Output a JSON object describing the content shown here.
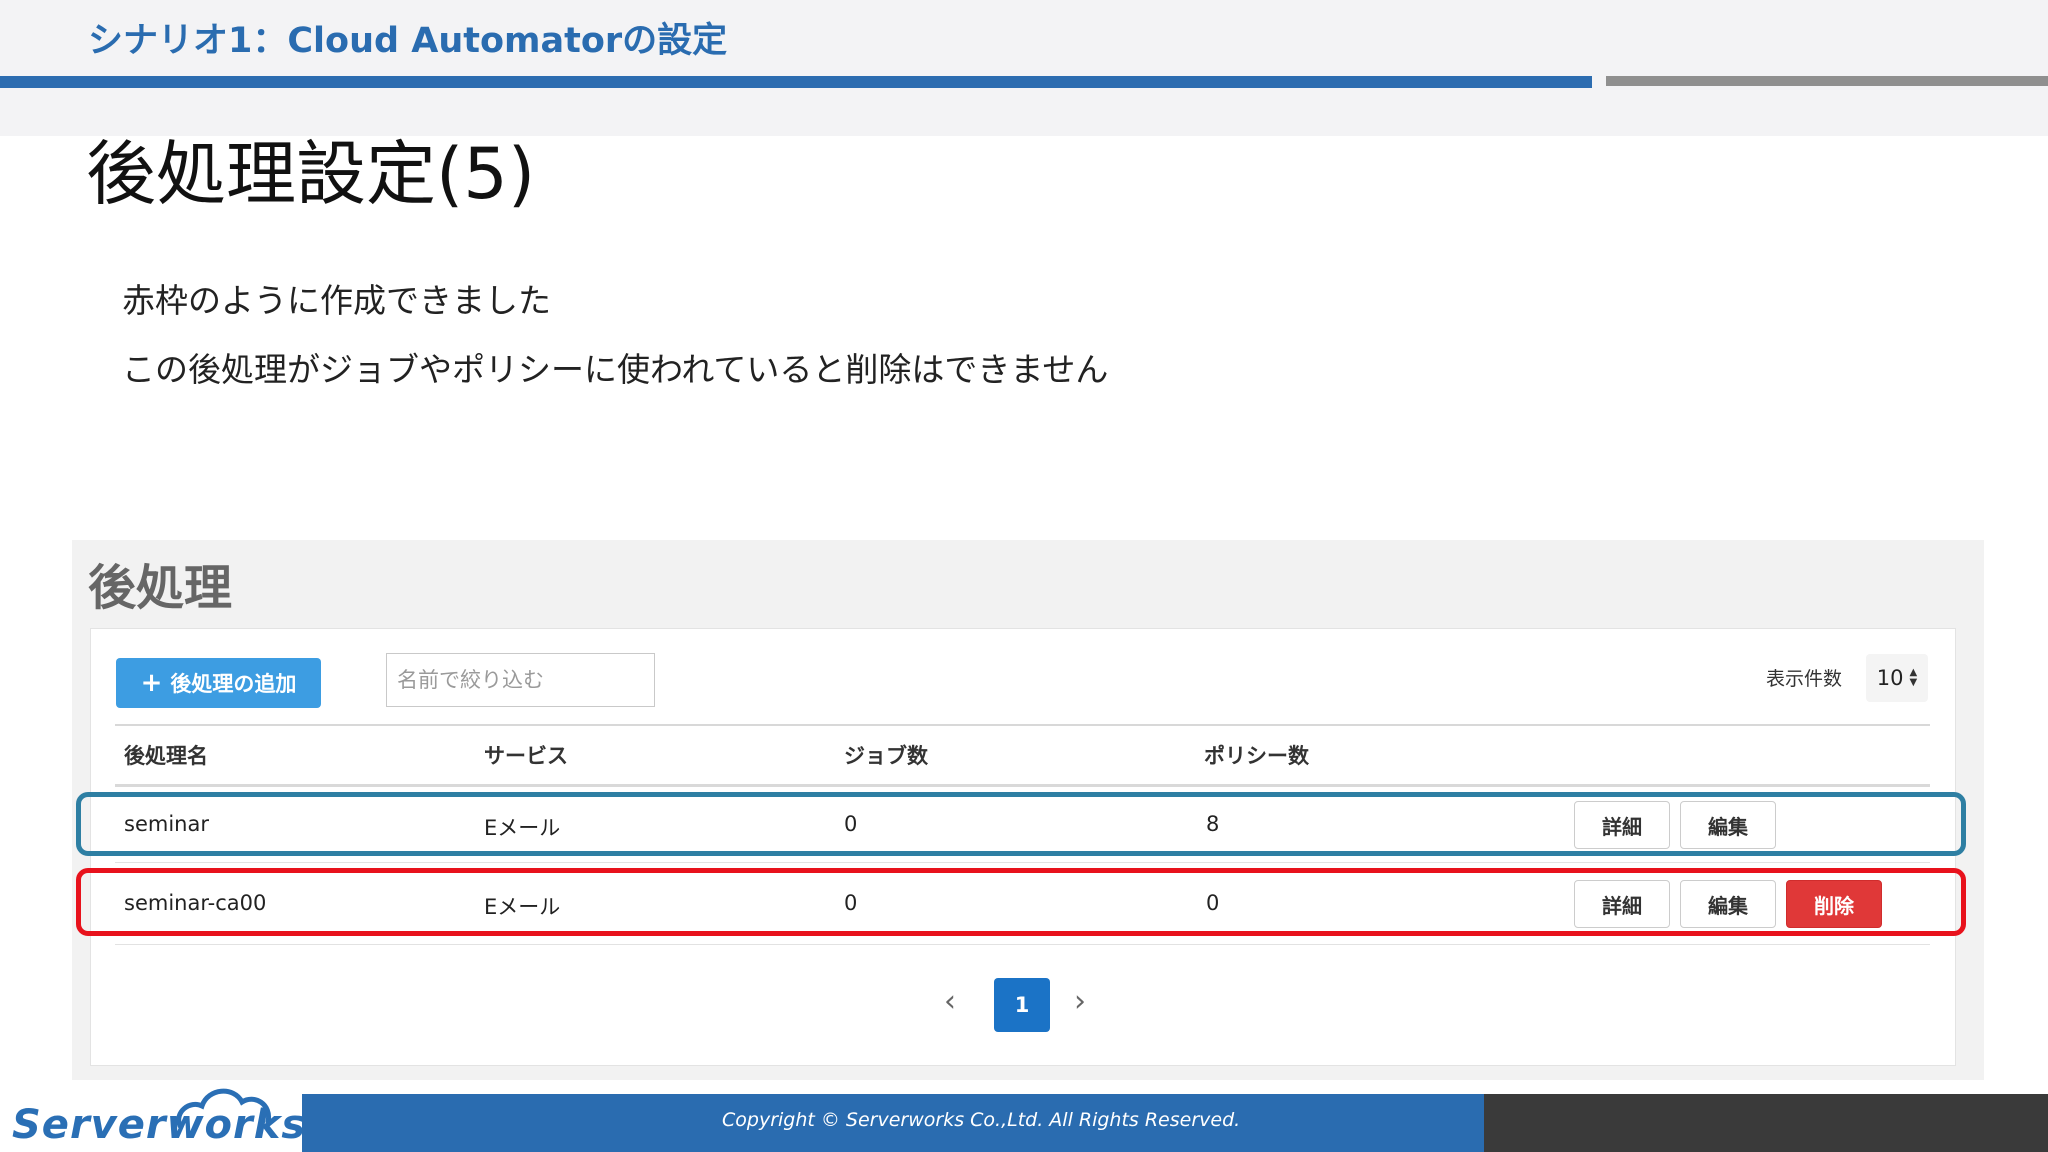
{
  "header": {
    "scenario_title": "シナリオ1：Cloud Automatorの設定"
  },
  "slide": {
    "title": "後処理設定(5)",
    "lines": [
      "赤枠のように作成できました",
      "この後処理がジョブやポリシーに使われていると削除はできません"
    ]
  },
  "app": {
    "panel_title": "後処理",
    "add_button_label": "後処理の追加",
    "filter_placeholder": "名前で絞り込む",
    "per_page_label": "表示件数",
    "per_page_value": "10",
    "columns": [
      "後処理名",
      "サービス",
      "ジョブ数",
      "ポリシー数"
    ],
    "rows": [
      {
        "name": "seminar",
        "service": "Eメール",
        "jobs": "0",
        "policies": "8",
        "detail_label": "詳細",
        "edit_label": "編集"
      },
      {
        "name": "seminar-ca00",
        "service": "Eメール",
        "jobs": "0",
        "policies": "0",
        "detail_label": "詳細",
        "edit_label": "編集",
        "delete_label": "削除"
      }
    ],
    "pagination": {
      "prev_icon": "‹",
      "current_page": "1",
      "next_icon": "›"
    },
    "icons": {
      "add": "plus-icon",
      "per_page": "sort-icon",
      "prev": "chevron-left-icon",
      "next": "chevron-right-icon"
    }
  },
  "highlights": {
    "blue_color": "#2e7fa3",
    "red_color": "#e8121c"
  },
  "footer": {
    "logo_text": "Serverworks",
    "copyright": "Copyright ©  Serverworks Co.,Ltd. All Rights Reserved."
  }
}
